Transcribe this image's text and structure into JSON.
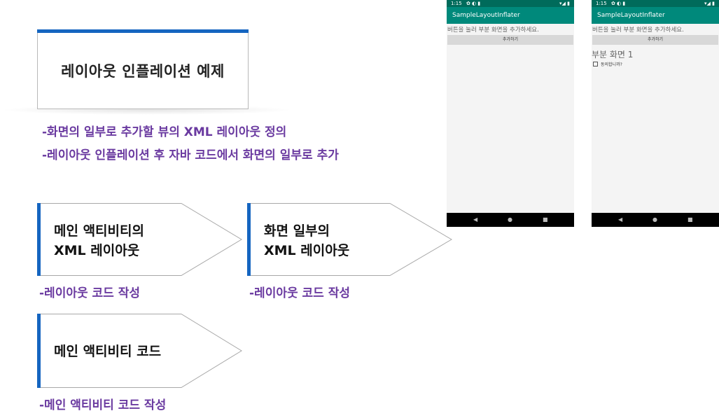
{
  "slide": {
    "title": "레이아웃 인플레이션 예제",
    "bullets": [
      "-화면의 일부로 추가할 뷰의 XML 레이아웃 정의",
      "-레이아웃 인플레이션 후 자바 코드에서 화면의 일부로 추가"
    ],
    "cards": [
      {
        "line1": "메인 액티비티의",
        "line2": "XML 레이아웃",
        "sub": "-레이아웃 코드 작성"
      },
      {
        "line1": "화면 일부의",
        "line2": "XML 레이아웃",
        "sub": "-레이아웃 코드 작성"
      },
      {
        "line1": "메인 액티비티 코드",
        "line2": "",
        "sub": "-메인 액티비티 코드 작성"
      }
    ]
  },
  "phones": [
    {
      "status_time": "1:15",
      "status_icons": "✿ ◐ ▮",
      "status_right": "▾◢ ▮",
      "app_title": "SampleLayoutInflater",
      "hint": "버튼을 눌러 부분 화면을 추가하세요.",
      "button_label": "추가하기",
      "partial_title": "",
      "checkbox_label": ""
    },
    {
      "status_time": "1:15",
      "status_icons": "✿ ◐ ▮",
      "status_right": "▾◢ ▮",
      "app_title": "SampleLayoutInflater",
      "hint": "버튼을 눌러 부분 화면을 추가하세요.",
      "button_label": "추가하기",
      "partial_title": "부분 화면 1",
      "checkbox_label": "동의합니까?"
    }
  ],
  "nav_icons": {
    "back": "◀",
    "home": "●",
    "recents": "■"
  },
  "colors": {
    "accent_blue": "#1565c0",
    "bullet_purple": "#6a3aa0",
    "statusbar": "#006b5b",
    "appbar": "#00897b"
  }
}
